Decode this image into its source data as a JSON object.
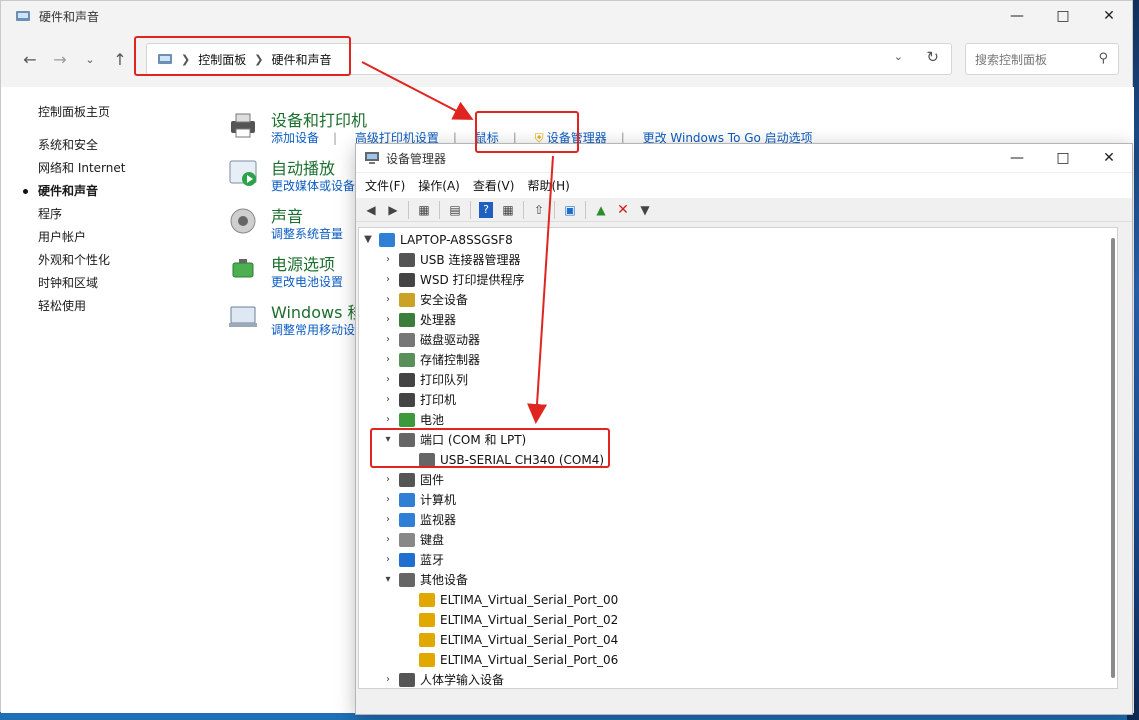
{
  "control_panel": {
    "window_title": "硬件和声音",
    "breadcrumb": [
      "控制面板",
      "硬件和声音"
    ],
    "search_placeholder": "搜索控制面板",
    "left_nav": {
      "home": "控制面板主页",
      "items": [
        "系统和安全",
        "网络和 Internet",
        "硬件和声音",
        "程序",
        "用户帐户",
        "外观和个性化",
        "时钟和区域",
        "轻松使用"
      ],
      "active": "硬件和声音"
    },
    "categories": [
      {
        "title": "设备和打印机",
        "links": [
          "添加设备",
          "高级打印机设置",
          "鼠标",
          "设备管理器",
          "更改 Windows To Go 启动选项"
        ],
        "icon": "printer-icon"
      },
      {
        "title": "自动播放",
        "links": [
          "更改媒体或设备的默认设置"
        ],
        "icon": "autoplay-icon"
      },
      {
        "title": "声音",
        "links": [
          "调整系统音量"
        ],
        "icon": "speaker-icon"
      },
      {
        "title": "电源选项",
        "links": [
          "更改电池设置"
        ],
        "icon": "battery-icon"
      },
      {
        "title": "Windows 移动中心",
        "links": [
          "调整常用移动设置"
        ],
        "icon": "mobility-center-icon"
      }
    ]
  },
  "device_manager": {
    "window_title": "设备管理器",
    "menu": [
      "文件(F)",
      "操作(A)",
      "查看(V)",
      "帮助(H)"
    ],
    "root": "LAPTOP-A8SSGSF8",
    "tree": [
      {
        "label": "USB 连接器管理器",
        "expanded": false,
        "icon_color": "#555555"
      },
      {
        "label": "WSD 打印提供程序",
        "expanded": false,
        "icon_color": "#444444"
      },
      {
        "label": "安全设备",
        "expanded": false,
        "icon_color": "#c9a227"
      },
      {
        "label": "处理器",
        "expanded": false,
        "icon_color": "#3b7d3b"
      },
      {
        "label": "磁盘驱动器",
        "expanded": false,
        "icon_color": "#777777"
      },
      {
        "label": "存储控制器",
        "expanded": false,
        "icon_color": "#5a8f5a"
      },
      {
        "label": "打印队列",
        "expanded": false,
        "icon_color": "#444444"
      },
      {
        "label": "打印机",
        "expanded": false,
        "icon_color": "#444444"
      },
      {
        "label": "电池",
        "expanded": false,
        "icon_color": "#3c9a3c"
      },
      {
        "label": "端口 (COM 和 LPT)",
        "expanded": true,
        "icon_color": "#666666",
        "children": [
          {
            "label": "USB-SERIAL CH340 (COM4)",
            "icon_color": "#666666"
          }
        ]
      },
      {
        "label": "固件",
        "expanded": false,
        "icon_color": "#555555"
      },
      {
        "label": "计算机",
        "expanded": false,
        "icon_color": "#2f7fd6"
      },
      {
        "label": "监视器",
        "expanded": false,
        "icon_color": "#2f7fd6"
      },
      {
        "label": "键盘",
        "expanded": false,
        "icon_color": "#888888"
      },
      {
        "label": "蓝牙",
        "expanded": false,
        "icon_color": "#1f6fd0"
      },
      {
        "label": "其他设备",
        "expanded": true,
        "icon_color": "#666666",
        "children": [
          {
            "label": "ELTIMA_Virtual_Serial_Port_00",
            "icon_color": "#e0a800"
          },
          {
            "label": "ELTIMA_Virtual_Serial_Port_02",
            "icon_color": "#e0a800"
          },
          {
            "label": "ELTIMA_Virtual_Serial_Port_04",
            "icon_color": "#e0a800"
          },
          {
            "label": "ELTIMA_Virtual_Serial_Port_06",
            "icon_color": "#e0a800"
          }
        ]
      },
      {
        "label": "人体学输入设备",
        "expanded": false,
        "icon_color": "#555555"
      }
    ]
  },
  "accent_colors": {
    "highlight_red": "#e0241f",
    "link_blue": "#0b5cc2",
    "category_green": "#1c6f2e"
  }
}
